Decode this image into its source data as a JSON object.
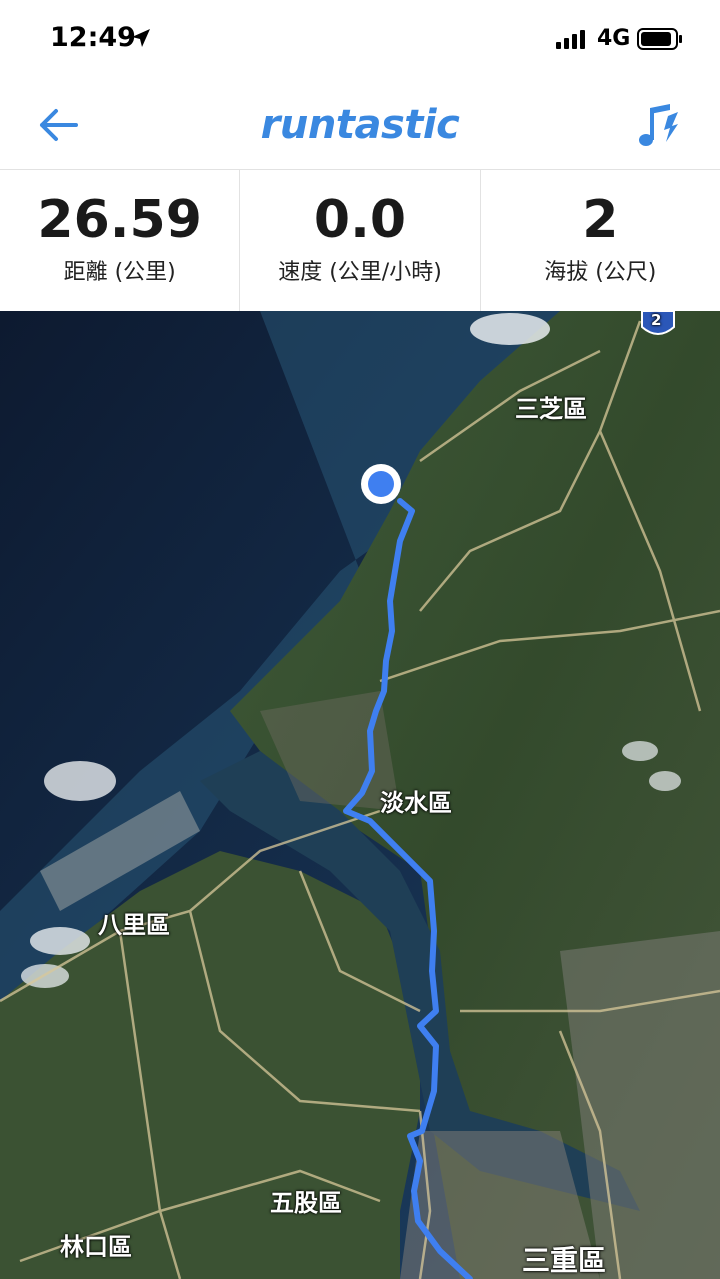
{
  "status_bar": {
    "time": "12:49",
    "network": "4G",
    "icons": [
      "location-arrow-icon",
      "signal-icon",
      "battery-icon"
    ]
  },
  "nav": {
    "brand": "runtastic",
    "back_icon": "arrow-left-icon",
    "music_icon": "music-note-icon",
    "accent_color": "#3a88e0"
  },
  "stats": [
    {
      "value": "26.59",
      "label": "距離 (公里)"
    },
    {
      "value": "0.0",
      "label": "速度 (公里/小時)"
    },
    {
      "value": "2",
      "label": "海拔 (公尺)"
    }
  ],
  "map": {
    "route_color": "#3f7ff0",
    "highway_badge": "2",
    "places": {
      "sanzhi": "三芝區",
      "tamsui": "淡水區",
      "bali": "八里區",
      "wugu": "五股區",
      "linkou": "林口區",
      "sanchong": "三重區"
    }
  }
}
